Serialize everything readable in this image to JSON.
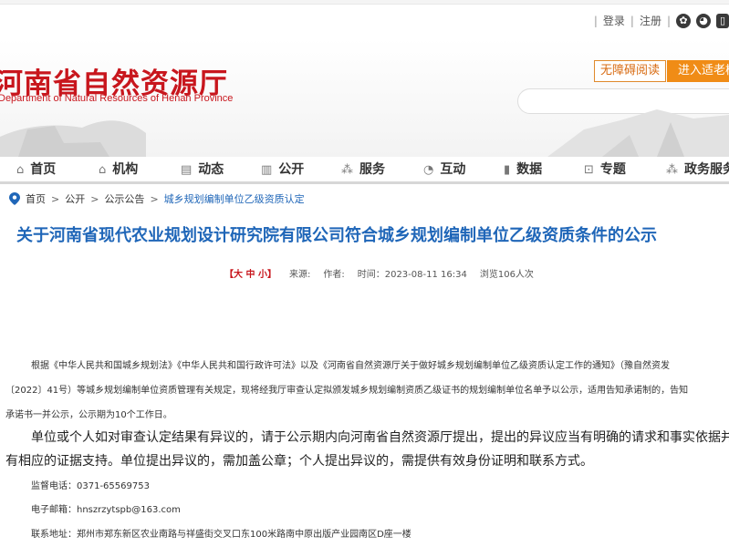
{
  "topbar": {
    "login": "登录",
    "register": "注册"
  },
  "header": {
    "title": "河南省自然资源厅",
    "subtitle": "Department of Natural Resources of Henan Province",
    "accessibility": "无障碍阅读",
    "elder_mode": "进入适老模式"
  },
  "nav": [
    {
      "icon": "⌂",
      "label": "首页"
    },
    {
      "icon": "⌂",
      "label": "机构"
    },
    {
      "icon": "▤",
      "label": "动态"
    },
    {
      "icon": "▥",
      "label": "公开"
    },
    {
      "icon": "⁂",
      "label": "服务"
    },
    {
      "icon": "◔",
      "label": "互动"
    },
    {
      "icon": "▮",
      "label": "数据"
    },
    {
      "icon": "⊡",
      "label": "专题"
    },
    {
      "icon": "⁂",
      "label": "政务服务"
    }
  ],
  "breadcrumb": {
    "home": "首页",
    "open": "公开",
    "notice": "公示公告",
    "current": "城乡规划编制单位乙级资质认定"
  },
  "article": {
    "title": "关于河南省现代农业规划设计研究院有限公司符合城乡规划编制单位乙级资质条件的公示",
    "font_size": "【大 中 小】",
    "source": "来源:",
    "author": "作者:",
    "time": "时间：2023-08-11 16:34",
    "views": "浏览106人次",
    "p1_line1": "根据《中华人民共和国城乡规划法》《中华人民共和国行政许可法》以及《河南省自然资源厅关于做好城乡规划编制单位乙级资质认定工作的通知》（豫自然资发",
    "p1_line2": "〔2022〕41号）等城乡规划编制单位资质管理有关规定，现将经我厅审查认定拟颁发城乡规划编制资质乙级证书的规划编制单位名单予以公示，适用告知承诺制的，告知",
    "p1_line3": "承诺书一并公示，公示期为10个工作日。",
    "p2_line1": "单位或个人如对审查认定结果有异议的，请于公示期内向河南省自然资源厅提出，提出的异议应当有明确的请求和事实依据并",
    "p2_line2": "有相应的证据支持。单位提出异议的，需加盖公章；个人提出异议的，需提供有效身份证明和联系方式。",
    "phone": "监督电话：0371-65569753",
    "email": "电子邮箱：hnszrzytspb@163.com",
    "address": "联系地址：郑州市郑东新区农业南路与祥盛街交叉口东100米路南中原出版产业园南区D座一楼"
  }
}
